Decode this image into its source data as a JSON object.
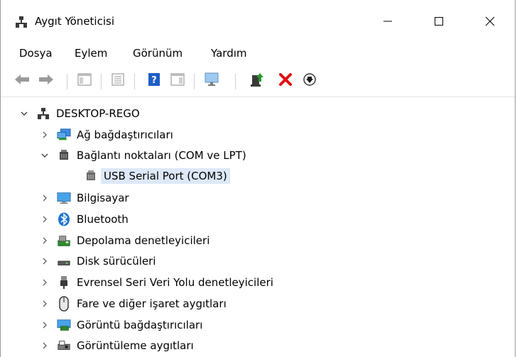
{
  "window": {
    "title": "Aygıt Yöneticisi"
  },
  "menu": [
    "Dosya",
    "Eylem",
    "Görünüm",
    "Yardım"
  ],
  "toolbar_icons": [
    "back-icon",
    "forward-icon",
    "show-hide-console-tree-icon",
    "properties-icon",
    "help-icon",
    "action-pane-icon",
    "scan-hardware-icon",
    "update-driver-icon",
    "uninstall-icon",
    "disable-device-icon"
  ],
  "tree": {
    "root": "DESKTOP-REGO",
    "nodes": [
      {
        "label": "Ağ bağdaştırıcıları",
        "icon": "network-adapter-icon",
        "expanded": false
      },
      {
        "label": "Bağlantı noktaları (COM ve LPT)",
        "icon": "port-icon",
        "expanded": true
      },
      {
        "label": "USB Serial Port (COM3)",
        "icon": "port-icon",
        "child": true,
        "selected": true
      },
      {
        "label": "Bilgisayar",
        "icon": "computer-icon",
        "expanded": false
      },
      {
        "label": "Bluetooth",
        "icon": "bluetooth-icon",
        "expanded": false
      },
      {
        "label": "Depolama denetleyicileri",
        "icon": "storage-controller-icon",
        "expanded": false
      },
      {
        "label": "Disk sürücüleri",
        "icon": "disk-drive-icon",
        "expanded": false
      },
      {
        "label": "Evrensel Seri Veri Yolu denetleyicileri",
        "icon": "usb-icon",
        "expanded": false
      },
      {
        "label": "Fare ve diğer işaret aygıtları",
        "icon": "mouse-icon",
        "expanded": false
      },
      {
        "label": "Görüntü bağdaştırıcıları",
        "icon": "display-adapter-icon",
        "expanded": false
      },
      {
        "label": "Görüntüleme aygıtları",
        "icon": "imaging-device-icon",
        "expanded": false
      }
    ]
  },
  "colors": {
    "selection": "#dde8f8",
    "accent_blue": "#1e73d2",
    "uninstall_red": "#e01010",
    "update_green": "#2a9a2a"
  }
}
